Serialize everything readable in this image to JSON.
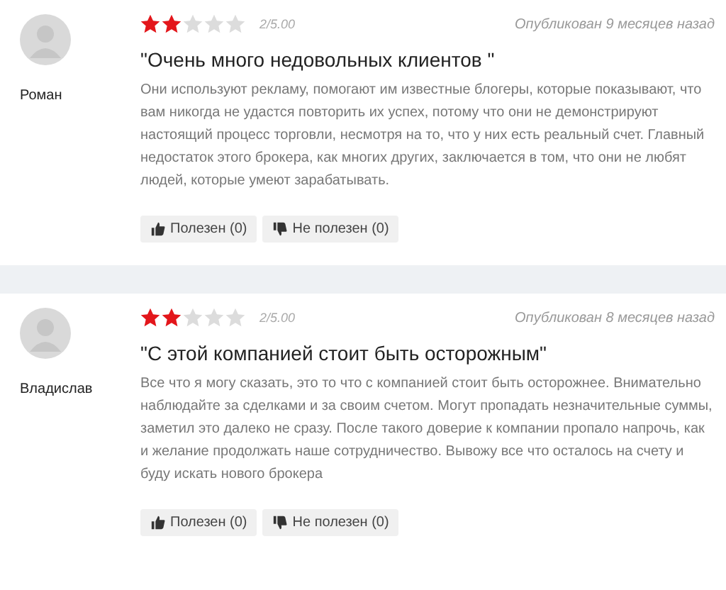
{
  "reviews": [
    {
      "author": "Роман",
      "stars": 2,
      "score": "2/5.00",
      "published": "Опубликован 9 месяцев назад",
      "title": "\"Очень много недовольных клиентов \"",
      "text": "Они используют рекламу, помогают им известные блогеры, которые показывают, что вам никогда не удастся повторить их успех, потому что они не демонстрируют настоящий процесс торговли, несмотря на то, что у них есть реальный счет. Главный недостаток этого брокера, как многих других, заключается в том, что они не любят людей, которые умеют зарабатывать.",
      "helpful": "Полезен (0)",
      "unhelpful": "Не полезен (0)"
    },
    {
      "author": "Владислав",
      "stars": 2,
      "score": "2/5.00",
      "published": "Опубликован 8 месяцев назад",
      "title": "\"С этой компанией стоит быть осторожным\"",
      "text": "Все что я могу сказать, это то что с компанией стоит быть осторожнее. Внимательно наблюдайте за сделками и за своим счетом. Могут пропадать незначительные суммы, заметил это далеко не сразу. После такого доверие к компании пропало напрочь, как и желание продолжать наше сотрудничество. Вывожу все что осталось на счету и буду искать нового брокера",
      "helpful": "Полезен (0)",
      "unhelpful": "Не полезен (0)"
    }
  ]
}
